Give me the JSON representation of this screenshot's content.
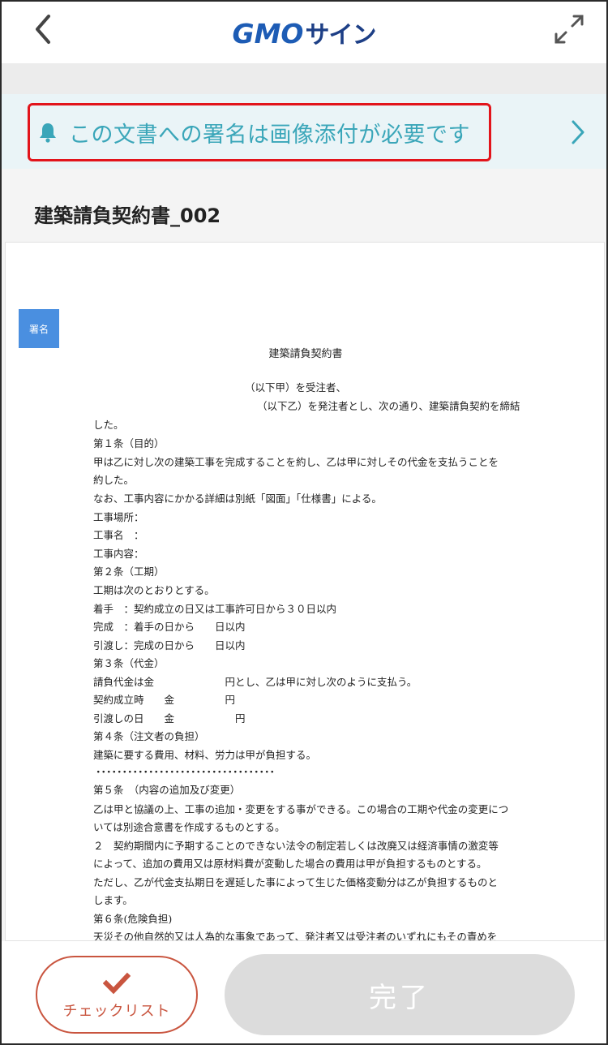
{
  "header": {
    "logo_gmo": "GMO",
    "logo_sign": "サイン"
  },
  "notice": {
    "text": "この文書への署名は画像添付が必要です"
  },
  "document": {
    "title": "建築請負契約書_002",
    "sign_badge": "署名",
    "heading": "建築請負契約書",
    "lines": [
      "（以下甲）を受注者、",
      "（以下乙）を発注者とし、次の通り、建築請負契約を締結",
      "した。",
      "第１条（目的）",
      "甲は乙に対し次の建築工事を完成することを約し、乙は甲に対しその代金を支払うことを",
      "約した。",
      "なお、工事内容にかかる詳細は別紙「図面」「仕様書」による。",
      "工事場所：",
      "工事名　：",
      "工事内容：",
      "第２条（工期）",
      "工期は次のとおりとする。",
      "着手　：契約成立の日又は工事許可日から３０日以内",
      "完成　：着手の日から　　日以内",
      "引渡し：完成の日から　　日以内",
      "第３条（代金）",
      "請負代金は金　　　　　　　円とし、乙は甲に対し次のように支払う。",
      "契約成立時　　金　　　　　円",
      "引渡しの日　　金　　　　　　円",
      "第４条（注文者の負担）",
      "建築に要する費用、材料、労力は甲が負担する。",
      "・・・・・・・・・・・・・・・・・・・・・・・・・・・・・・・・・・",
      "第５条　（内容の追加及び変更）",
      "乙は甲と協議の上、工事の追加・変更をする事ができる。この場合の工期や代金の変更につ",
      "いては別途合意書を作成するものとする。",
      "２　契約期間内に予期することのできない法令の制定若しくは改廃又は経済事情の激変等",
      "によって、追加の費用又は原材料費が変動した場合の費用は甲が負担するものとする。",
      "ただし、乙が代金支払期日を遅延した事によって生じた価格変動分は乙が負担するものと",
      "します。",
      "第６条(危険負担)",
      "天災その他自然的又は人為的な事象であって、発注者又は受注者のいずれにもその責めを"
    ]
  },
  "footer": {
    "checklist_label": "チェックリスト",
    "complete_label": "完了"
  },
  "colors": {
    "brand_blue": "#1d5cb5",
    "notice_text": "#3aa6b9",
    "highlight_red": "#e2141b",
    "checklist_accent": "#c9553f",
    "disabled_button": "#dcdcdc",
    "sign_badge": "#4a8fe0"
  }
}
